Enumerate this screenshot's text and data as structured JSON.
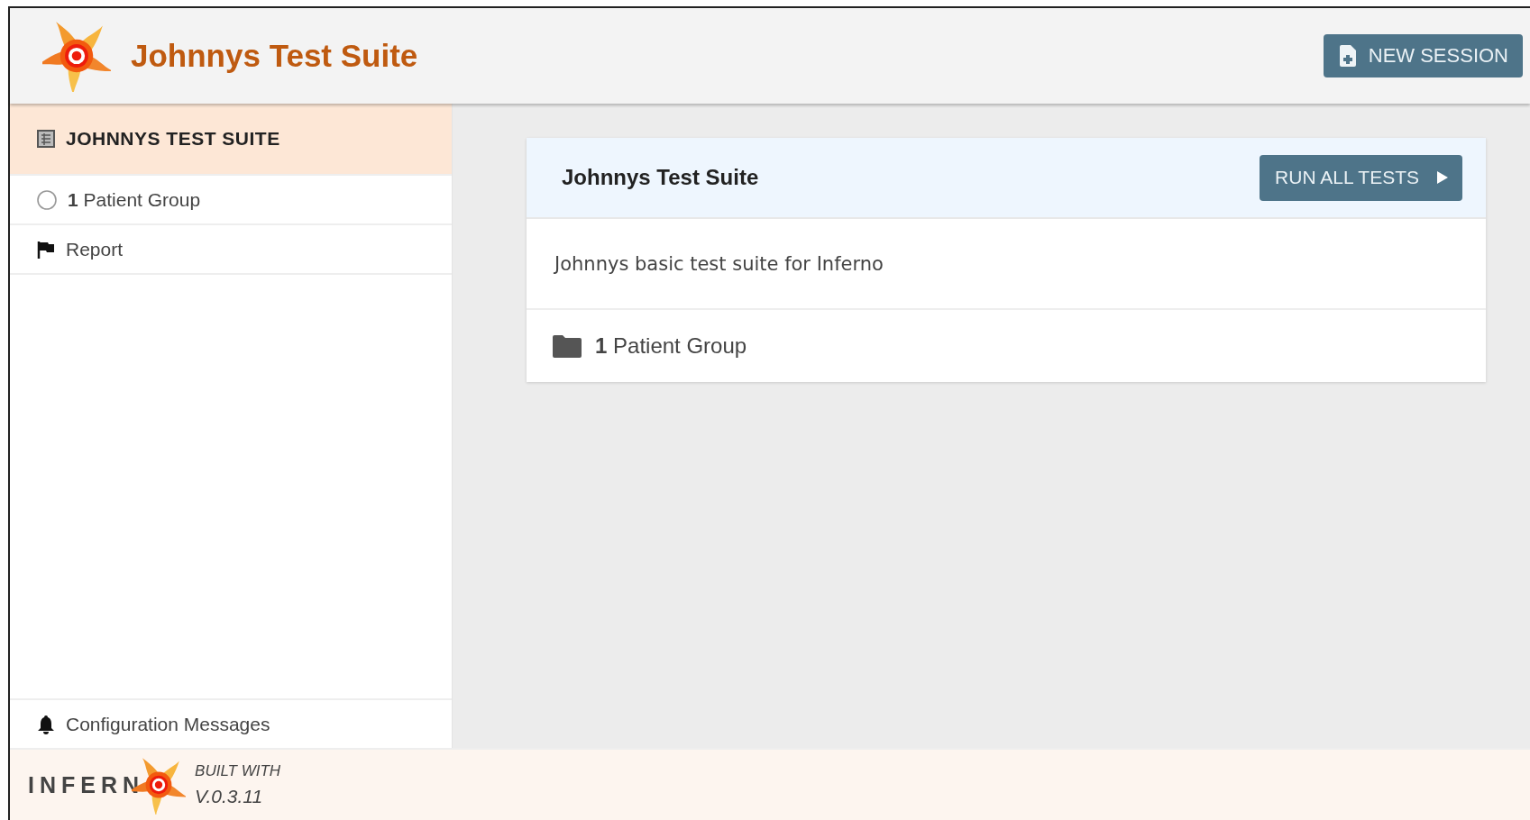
{
  "header": {
    "title": "Johnnys Test Suite",
    "new_session_button": "NEW SESSION"
  },
  "sidebar": {
    "items": [
      {
        "kind": "suite",
        "label": "JOHNNYS TEST SUITE",
        "selected": true
      },
      {
        "kind": "group",
        "label": "**1** Patient Group",
        "selected": false
      },
      {
        "kind": "report",
        "label": "Report",
        "selected": false
      }
    ],
    "config_messages": "Configuration Messages"
  },
  "card": {
    "title": "Johnnys Test Suite",
    "run_button": "RUN ALL TESTS",
    "description": "Johnnys basic test suite for Inferno",
    "groups": [
      {
        "label": "**1** Patient Group"
      }
    ]
  },
  "footer": {
    "brand": "INFERN",
    "built_with": "BUILT WITH",
    "version": "V.0.3.11"
  }
}
